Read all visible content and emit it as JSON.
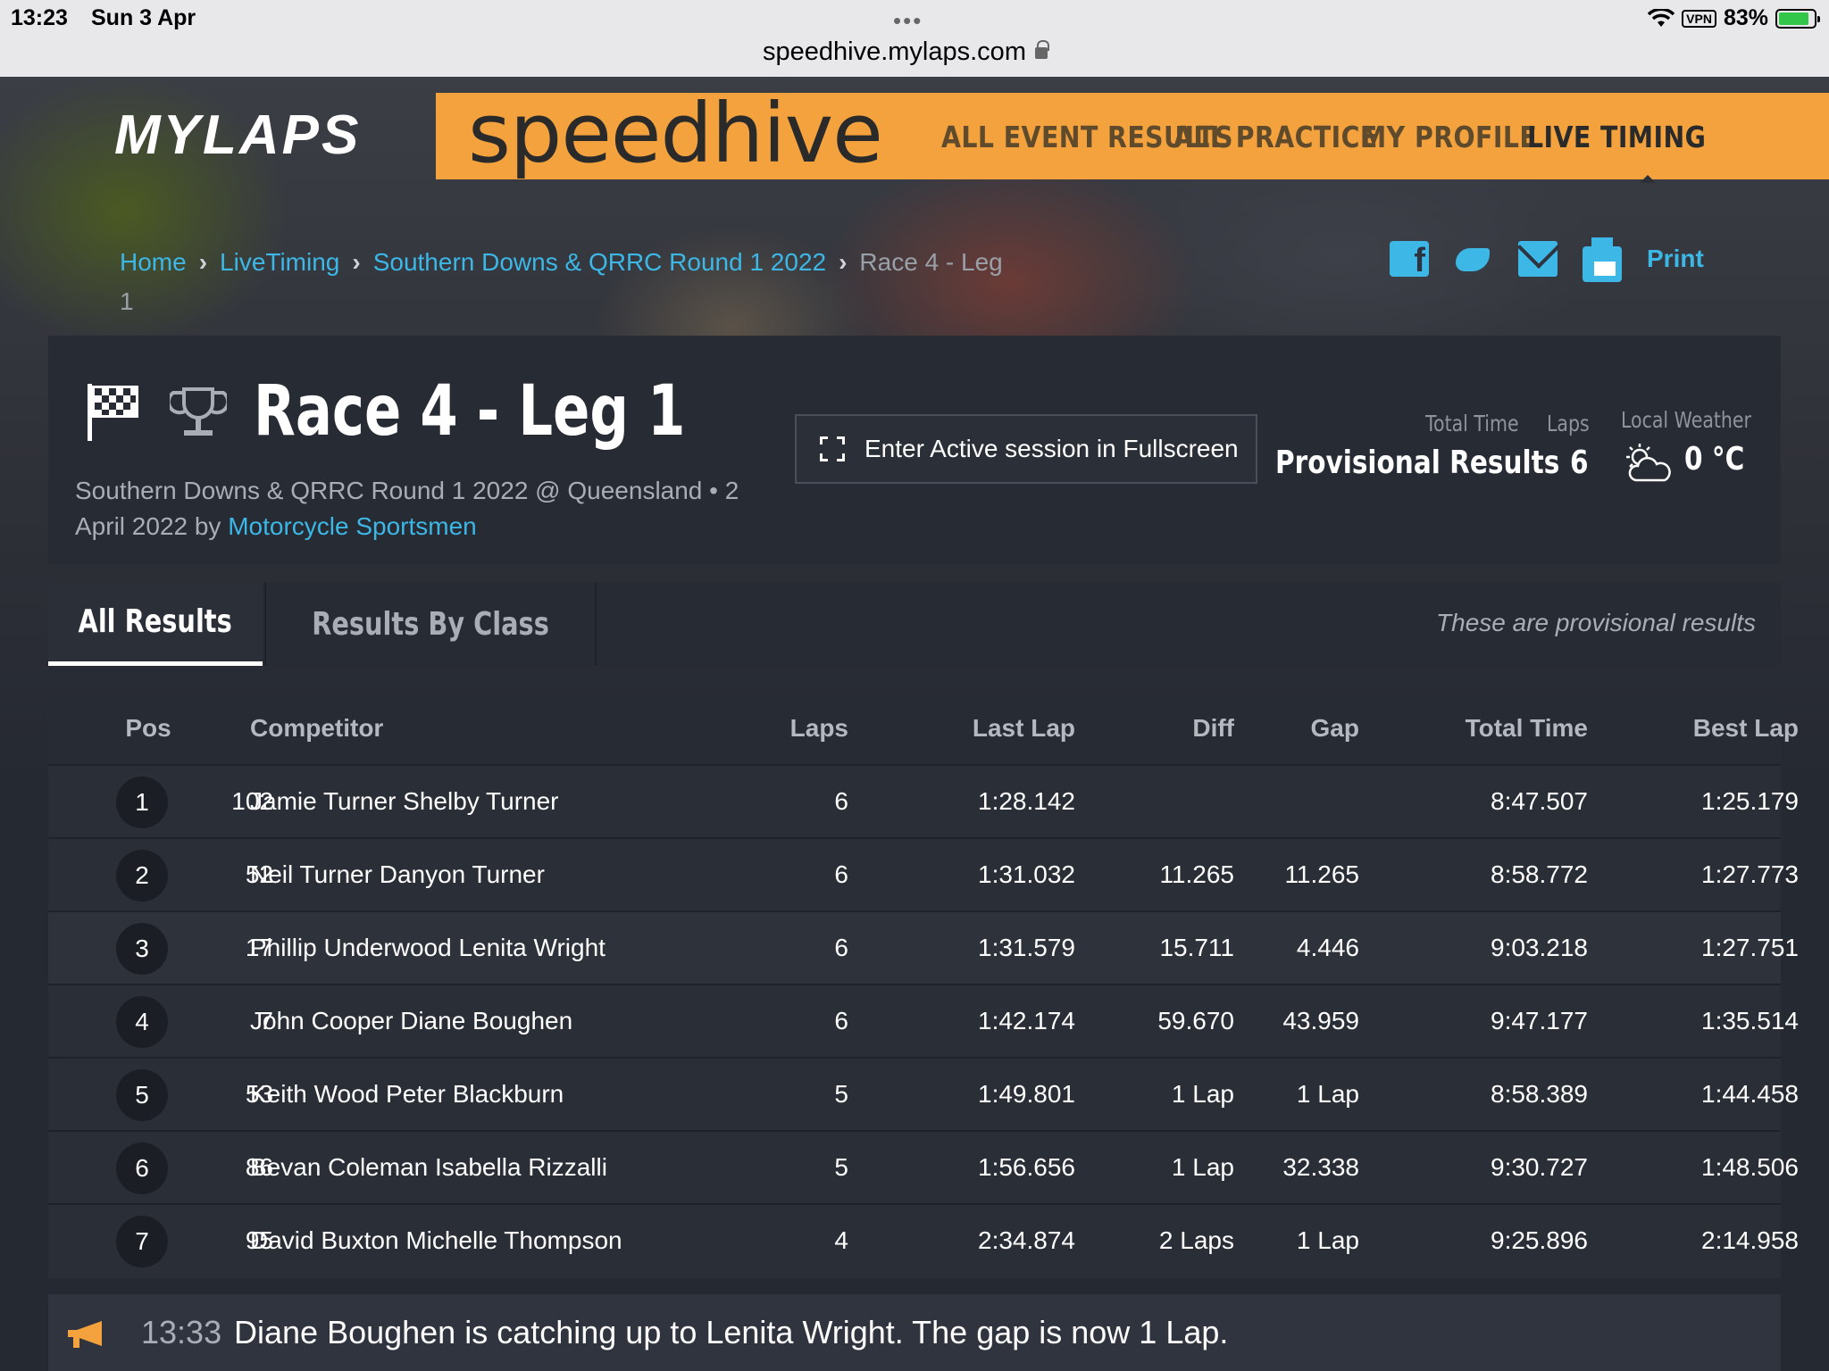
{
  "status_bar": {
    "time": "13:23",
    "date": "Sun 3 Apr",
    "dots": "•••",
    "url": "speedhive.mylaps.com",
    "vpn": "VPN",
    "battery": "83%"
  },
  "brand": {
    "logo": "MYLAPS",
    "product": "speedhive",
    "accent_color": "#f3a23e",
    "link_color": "#3cb7e6"
  },
  "nav": [
    {
      "label": "ALL EVENT RESULTS"
    },
    {
      "label": "ALL PRACTICE"
    },
    {
      "label": "MY PROFILE"
    },
    {
      "label": "LIVE TIMING"
    }
  ],
  "breadcrumb": {
    "home": "Home",
    "live": "LiveTiming",
    "event": "Southern Downs & QRRC Round 1 2022",
    "current": "Race 4 - Leg 1"
  },
  "share": {
    "icons": [
      "facebook-icon",
      "twitter-icon",
      "mail-icon",
      "printer-icon"
    ],
    "print_label": "Print"
  },
  "session": {
    "title": "Race 4 - Leg 1",
    "meta": "Southern Downs & QRRC Round 1 2022 @ Queensland • 2 April 2022 by ",
    "organizer": "Motorcycle Sportsmen",
    "fullscreen_label": "Enter Active session in Fullscreen",
    "total_time_label": "Total Time",
    "total_time_value": "Provisional Results",
    "laps_label": "Laps",
    "laps_value": "6",
    "weather_label": "Local Weather",
    "weather_value": "0 °C"
  },
  "tabs": {
    "all": "All Results",
    "by_class": "Results By Class",
    "note": "These are provisional results"
  },
  "table": {
    "headers": {
      "pos": "Pos",
      "competitor": "Competitor",
      "laps": "Laps",
      "last_lap": "Last Lap",
      "diff": "Diff",
      "gap": "Gap",
      "total_time": "Total Time",
      "best_lap": "Best Lap"
    },
    "rows": [
      {
        "pos": "1",
        "num": "102",
        "name": "Jamie Turner Shelby Turner",
        "laps": "6",
        "last": "1:28.142",
        "diff": "",
        "gap": "",
        "total": "8:47.507",
        "best": "1:25.179"
      },
      {
        "pos": "2",
        "num": "52",
        "name": "Neil Turner Danyon Turner",
        "laps": "6",
        "last": "1:31.032",
        "diff": "11.265",
        "gap": "11.265",
        "total": "8:58.772",
        "best": "1:27.773"
      },
      {
        "pos": "3",
        "num": "17",
        "name": "Phillip Underwood Lenita Wright",
        "laps": "6",
        "last": "1:31.579",
        "diff": "15.711",
        "gap": "4.446",
        "total": "9:03.218",
        "best": "1:27.751"
      },
      {
        "pos": "4",
        "num": "7",
        "name": "John Cooper Diane Boughen",
        "laps": "6",
        "last": "1:42.174",
        "diff": "59.670",
        "gap": "43.959",
        "total": "9:47.177",
        "best": "1:35.514"
      },
      {
        "pos": "5",
        "num": "53",
        "name": "Keith Wood Peter Blackburn",
        "laps": "5",
        "last": "1:49.801",
        "diff": "1 Lap",
        "gap": "1 Lap",
        "total": "8:58.389",
        "best": "1:44.458"
      },
      {
        "pos": "6",
        "num": "86",
        "name": "Bevan Coleman Isabella Rizzalli",
        "laps": "5",
        "last": "1:56.656",
        "diff": "1 Lap",
        "gap": "32.338",
        "total": "9:30.727",
        "best": "1:48.506"
      },
      {
        "pos": "7",
        "num": "95",
        "name": "David Buxton Michelle Thompson",
        "laps": "4",
        "last": "2:34.874",
        "diff": "2 Laps",
        "gap": "1 Lap",
        "total": "9:25.896",
        "best": "2:14.958"
      }
    ]
  },
  "announcement": {
    "time": "13:33",
    "text": "Diane Boughen is catching up to Lenita Wright. The gap is now 1 Lap."
  }
}
